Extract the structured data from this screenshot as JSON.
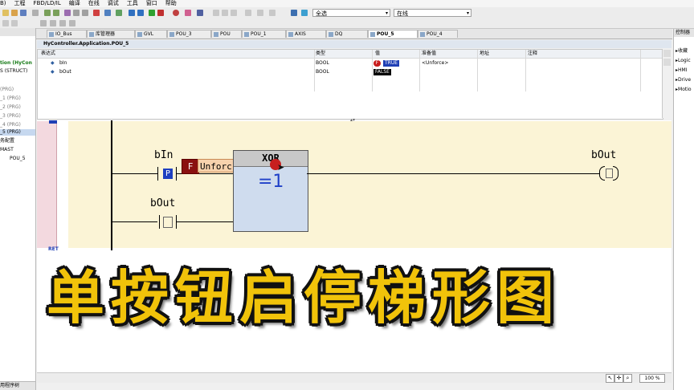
{
  "menu": [
    "B)",
    "工程",
    "FBD/LD/IL",
    "编译",
    "在线",
    "调试",
    "工具",
    "窗口",
    "帮助"
  ],
  "toolbar": {
    "combo1": "全选",
    "combo2": "在线"
  },
  "tabs": [
    "IO_Bus",
    "库管理器",
    "GVL",
    "POU_3",
    "POU",
    "POU_1",
    "AXIS",
    "DQ",
    "POU_5",
    "POU_4"
  ],
  "left_panel": {
    "items": [
      "tion (HyCon",
      "S (STRUCT)",
      "(PRG)",
      "_1 (PRG)",
      "_2 (PRG)",
      "_3 (PRG)",
      "_4 (PRG)",
      "_5 (PRG)",
      "务配置",
      "MAST",
      "POU_5"
    ],
    "bottom": "用程序树"
  },
  "right_panel": {
    "title": "控制器",
    "items": [
      "收藏",
      "Logic",
      "HMI",
      "Drive",
      "Motio"
    ]
  },
  "watch": {
    "path": "HyController.Application.POU_5",
    "columns": [
      "表达式",
      "类型",
      "值",
      "准备值",
      "地址",
      "注释"
    ],
    "rows": [
      {
        "name": "bIn",
        "type": "BOOL",
        "value": "TRUE",
        "prepared": "<Unforce>",
        "flag": "F"
      },
      {
        "name": "bOut",
        "type": "BOOL",
        "value": "FALSE",
        "prepared": "",
        "flag": ""
      }
    ]
  },
  "ladder": {
    "contact1_label": "bIn",
    "contact1_mark": "P",
    "force_flag": "F",
    "force_text": "Unforc",
    "contact2_label": "bOut",
    "block_title": "XOR",
    "block_op": "=1",
    "coil_label": "bOut",
    "ret_label": "RET"
  },
  "status": {
    "zoom": "100 %"
  },
  "overlay_title": "单按钮启停梯形图",
  "colors": {
    "accent_yellow": "#f1c30a",
    "rung_bg": "#fbf4d6",
    "block_bg": "#cfdcee",
    "true_bg": "#1f3fb5"
  }
}
